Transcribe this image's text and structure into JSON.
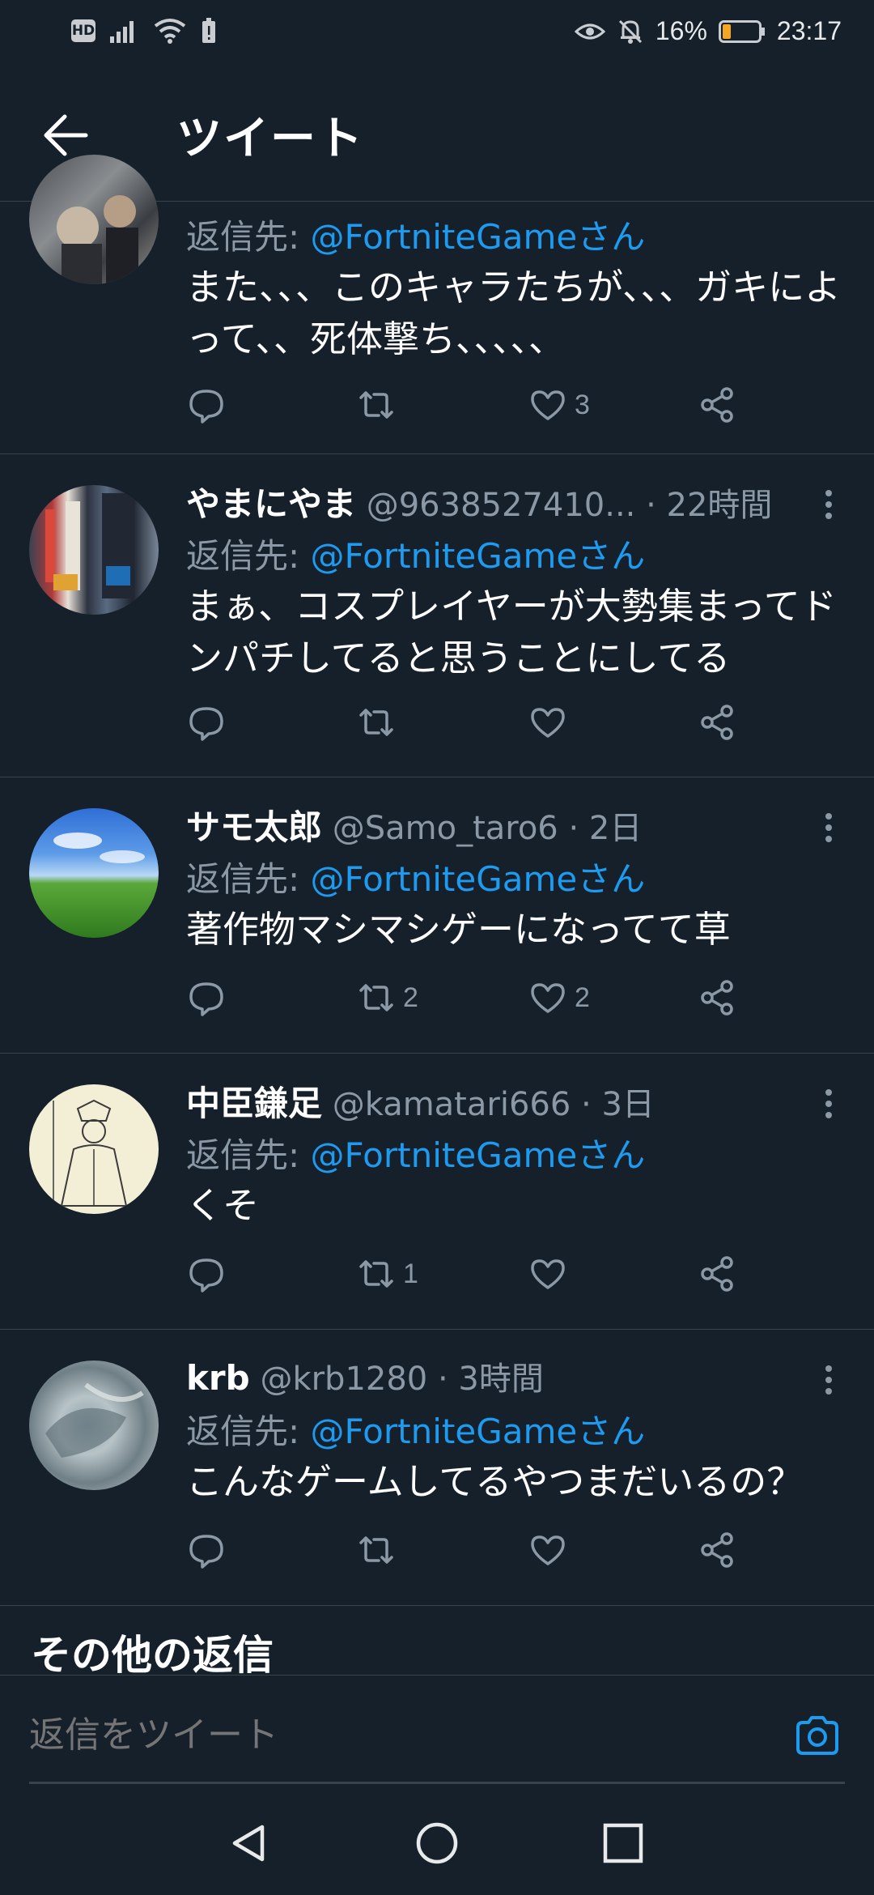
{
  "status_bar": {
    "hd": "HD",
    "battery_percent": "16%",
    "time": "23:17"
  },
  "header": {
    "title": "ツイート"
  },
  "tweets": [
    {
      "name": "",
      "handle": "",
      "time": "",
      "reply_prefix": "返信先:",
      "reply_mention": "@FortniteGameさん",
      "text": "また、、、このキャラたちが、、、ガキによって、、死体撃ち、、、、、",
      "reply_count": "",
      "retweet_count": "",
      "like_count": "3"
    },
    {
      "name": "やまにやま",
      "handle": "@9638527410...",
      "time": "· 22時間",
      "reply_prefix": "返信先:",
      "reply_mention": "@FortniteGameさん",
      "text": "まぁ、コスプレイヤーが大勢集まってドンパチしてると思うことにしてる",
      "reply_count": "",
      "retweet_count": "",
      "like_count": ""
    },
    {
      "name": "サモ太郎",
      "handle": "@Samo_taro6",
      "time": "· 2日",
      "reply_prefix": "返信先:",
      "reply_mention": "@FortniteGameさん",
      "text": "著作物マシマシゲーになってて草",
      "reply_count": "",
      "retweet_count": "2",
      "like_count": "2"
    },
    {
      "name": "中臣鎌足",
      "handle": "@kamatari666",
      "time": "· 3日",
      "reply_prefix": "返信先:",
      "reply_mention": "@FortniteGameさん",
      "text": "くそ",
      "reply_count": "",
      "retweet_count": "1",
      "like_count": ""
    },
    {
      "name": "krb",
      "handle": "@krb1280",
      "time": "· 3時間",
      "reply_prefix": "返信先:",
      "reply_mention": "@FortniteGameさん",
      "text": "こんなゲームしてるやつまだいるの？",
      "reply_count": "",
      "retweet_count": "",
      "like_count": ""
    }
  ],
  "other_replies": {
    "label": "その他の返信"
  },
  "composer": {
    "placeholder": "返信をツイート"
  },
  "colors": {
    "background": "#15202b",
    "accent": "#1d9bf0",
    "muted": "#8b98a5",
    "divider": "#38444d"
  }
}
